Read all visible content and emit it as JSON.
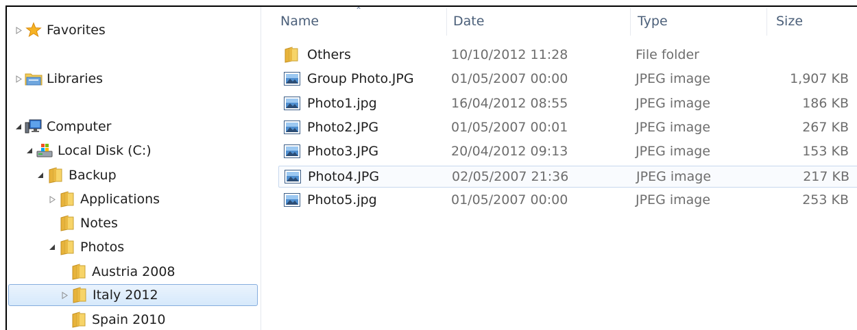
{
  "nav": {
    "favorites": "Favorites",
    "libraries": "Libraries",
    "computer": "Computer",
    "local_disk": "Local Disk (C:)",
    "backup": "Backup",
    "applications": "Applications",
    "notes": "Notes",
    "photos": "Photos",
    "austria": "Austria 2008",
    "italy": "Italy 2012",
    "spain": "Spain 2010"
  },
  "columns": {
    "name": "Name",
    "date": "Date",
    "type": "Type",
    "size": "Size"
  },
  "files": [
    {
      "name": "Others",
      "date": "10/10/2012 11:28",
      "type": "File folder",
      "size": "",
      "icon": "folder-icon"
    },
    {
      "name": "Group Photo.JPG",
      "date": "01/05/2007 00:00",
      "type": "JPEG image",
      "size": "1,907 KB",
      "icon": "image-file-icon"
    },
    {
      "name": "Photo1.jpg",
      "date": "16/04/2012 08:55",
      "type": "JPEG image",
      "size": "186 KB",
      "icon": "image-file-icon"
    },
    {
      "name": "Photo2.JPG",
      "date": "01/05/2007 00:01",
      "type": "JPEG image",
      "size": "267 KB",
      "icon": "image-file-icon"
    },
    {
      "name": "Photo3.JPG",
      "date": "20/04/2012 09:13",
      "type": "JPEG image",
      "size": "153 KB",
      "icon": "image-file-icon"
    },
    {
      "name": "Photo4.JPG",
      "date": "02/05/2007 21:36",
      "type": "JPEG image",
      "size": "217 KB",
      "icon": "image-file-icon"
    },
    {
      "name": "Photo5.jpg",
      "date": "01/05/2007 00:00",
      "type": "JPEG image",
      "size": "253 KB",
      "icon": "image-file-icon"
    }
  ],
  "colors": {
    "selection_border": "#84acdd",
    "selection_fill": "#d6e9fb",
    "folder": "#f2c64c",
    "header_text": "#4c607a"
  }
}
